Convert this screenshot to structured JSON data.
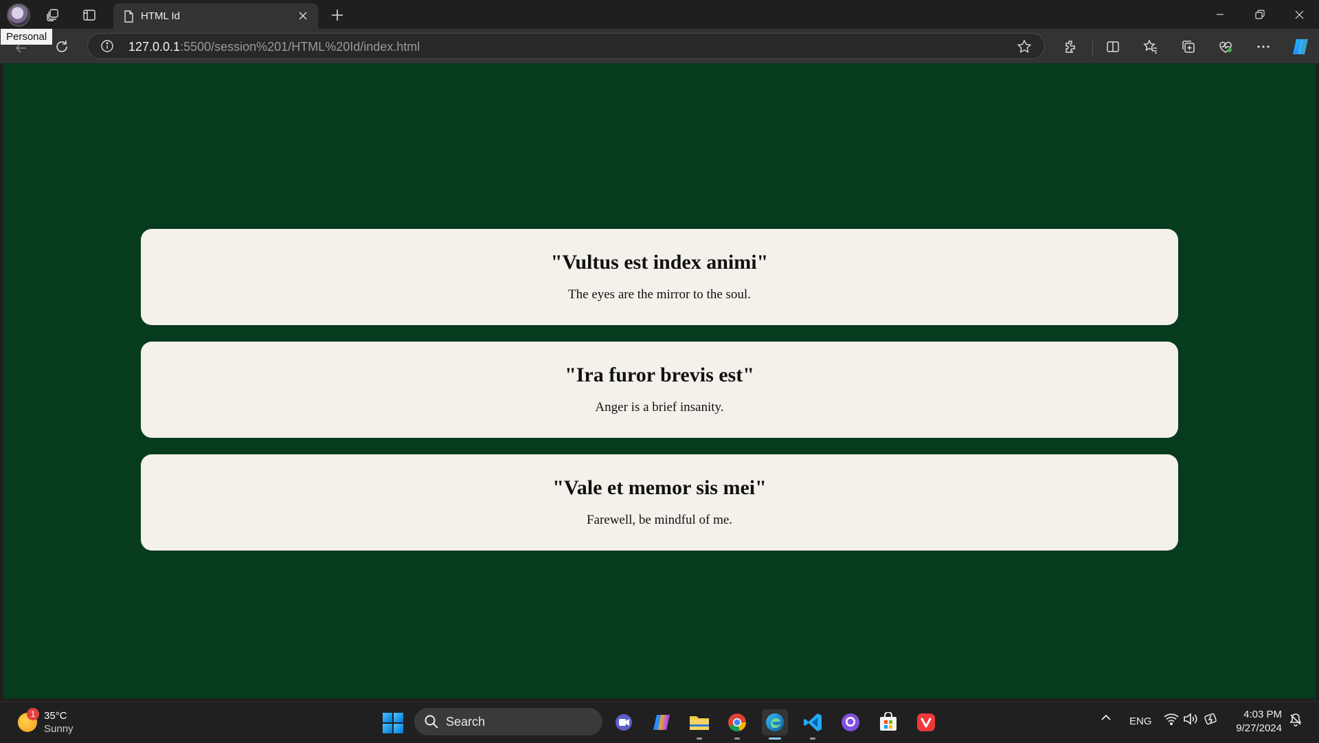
{
  "browser": {
    "profile_tooltip": "Personal",
    "tab_title": "HTML Id",
    "url_host": "127.0.0.1",
    "url_rest": ":5500/session%201/HTML%20Id/index.html"
  },
  "page": {
    "background": "#073b1d",
    "card_color": "#f3f1ea",
    "cards": [
      {
        "quote": "\"Vultus est index animi\"",
        "translation": "The eyes are the mirror to the soul."
      },
      {
        "quote": "\"Ira furor brevis est\"",
        "translation": "Anger is a brief insanity."
      },
      {
        "quote": "\"Vale et memor sis mei\"",
        "translation": "Farewell, be mindful of me."
      }
    ]
  },
  "taskbar": {
    "weather_temp": "35°C",
    "weather_desc": "Sunny",
    "weather_badge": "1",
    "search_label": "Search",
    "language": "ENG",
    "time": "4:03 PM",
    "date": "9/27/2024",
    "apps": [
      "teams-icon",
      "copilot-icon",
      "file-explorer-icon",
      "chrome-icon",
      "edge-icon",
      "vscode-icon",
      "github-icon",
      "store-icon",
      "vivaldi-icon"
    ]
  }
}
